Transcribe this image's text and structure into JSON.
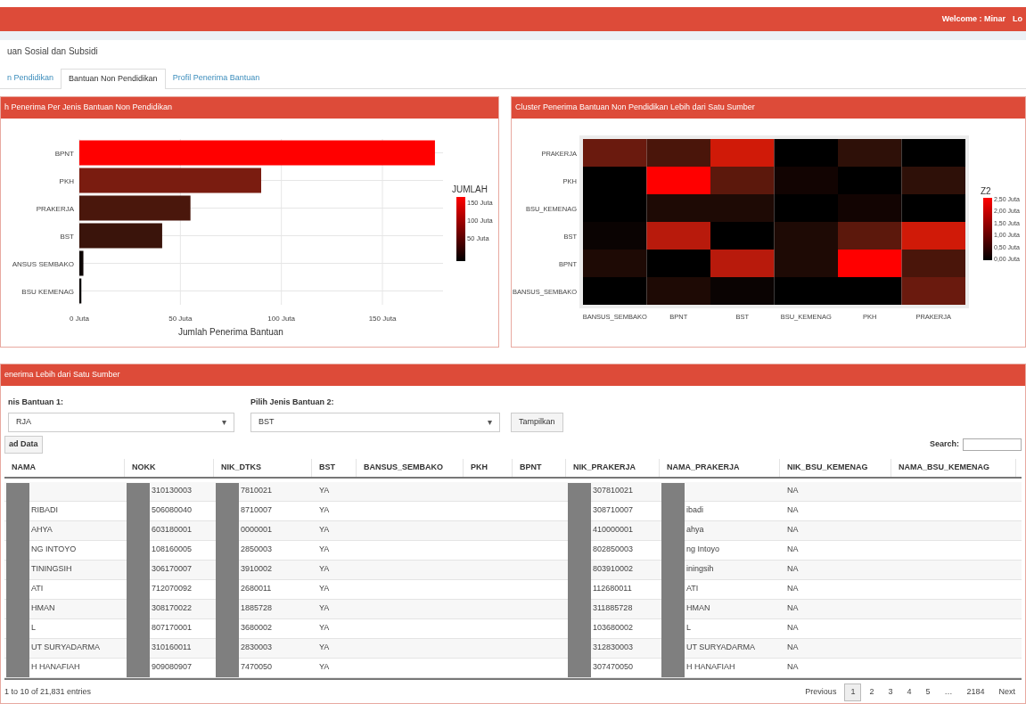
{
  "header": {
    "welcome": "Welcome : Minar",
    "logout": "Lo"
  },
  "page_title": "uan Sosial dan Subsidi",
  "tabs": [
    {
      "label": "n Pendidikan",
      "selected": false
    },
    {
      "label": "Bantuan Non Pendidikan",
      "selected": true
    },
    {
      "label": "Profil Penerima Bantuan",
      "selected": false
    }
  ],
  "bar_panel": {
    "title": "h Penerima Per Jenis Bantuan Non Pendidikan",
    "legend": {
      "title": "JUMLAH",
      "labels": [
        "150 Juta",
        "100 Juta",
        "50 Juta"
      ]
    },
    "chart_data": {
      "type": "bar",
      "orientation": "horizontal",
      "xlabel": "Jumlah Penerima Bantuan",
      "categories": [
        "BPNT",
        "PKH",
        "PRAKERJA",
        "BST",
        "ANSUS SEMBAKO",
        "BSU KEMENAG"
      ],
      "values": [
        176,
        90,
        55,
        41,
        2,
        1
      ],
      "colors": [
        "#ff0000",
        "#7a1c10",
        "#4a170c",
        "#3a140b",
        "#0d0504",
        "#080303"
      ],
      "grid": true,
      "xlim": [
        0,
        180
      ],
      "xticks": [
        {
          "value": 0,
          "label": "0 Juta"
        },
        {
          "value": 50,
          "label": "50 Juta"
        },
        {
          "value": 100,
          "label": "100 Juta"
        },
        {
          "value": 150,
          "label": "150 Juta"
        }
      ]
    }
  },
  "heatmap_panel": {
    "title": "Cluster Penerima Bantuan Non Pendidikan Lebih dari Satu Sumber",
    "columns": [
      "BANSUS_SEMBAKO",
      "BPNT",
      "BST",
      "BSU_KEMENAG",
      "PKH",
      "PRAKERJA"
    ],
    "rows": [
      {
        "label": "PRAKERJA",
        "cells": [
          {
            "color": "#6a1a0e"
          },
          {
            "color": "#4a150a"
          },
          {
            "color": "#d01a08"
          },
          {
            "color": "#000000"
          },
          {
            "color": "#2e1008"
          },
          {
            "color": "#000000"
          }
        ]
      },
      {
        "label": "PKH",
        "cells": [
          {
            "color": "#000000"
          },
          {
            "color": "#ff0000"
          },
          {
            "color": "#5c180c"
          },
          {
            "color": "#120402"
          },
          {
            "color": "#000000"
          },
          {
            "color": "#2e1008"
          }
        ]
      },
      {
        "label": "BSU_KEMENAG",
        "cells": [
          {
            "color": "#000000"
          },
          {
            "color": "#1e0a05"
          },
          {
            "color": "#1e0a05"
          },
          {
            "color": "#000000"
          },
          {
            "color": "#120402"
          },
          {
            "color": "#000000"
          }
        ]
      },
      {
        "label": "BST",
        "cells": [
          {
            "color": "#0a0302"
          },
          {
            "color": "#b81a0c"
          },
          {
            "color": "#000000"
          },
          {
            "color": "#1e0a05"
          },
          {
            "color": "#5c180c"
          },
          {
            "color": "#d01a08"
          }
        ]
      },
      {
        "label": "BPNT",
        "cells": [
          {
            "color": "#1e0a05"
          },
          {
            "color": "#000000"
          },
          {
            "color": "#b81a0c"
          },
          {
            "color": "#1e0a05"
          },
          {
            "color": "#ff0000"
          },
          {
            "color": "#4a150a"
          }
        ]
      },
      {
        "label": "BANSUS_SEMBAKO",
        "cells": [
          {
            "color": "#000000"
          },
          {
            "color": "#1e0a05"
          },
          {
            "color": "#0a0302"
          },
          {
            "color": "#000000"
          },
          {
            "color": "#000000"
          },
          {
            "color": "#6a1a0e"
          }
        ]
      }
    ],
    "legend": {
      "title": "Z2",
      "labels": [
        "2,50 Juta",
        "2,00 Juta",
        "1,50 Juta",
        "1,00 Juta",
        "0,50 Juta",
        "0,00 Juta"
      ]
    }
  },
  "table_panel": {
    "title": "enerima Lebih dari Satu Sumber",
    "select_1": {
      "label": "nis Bantuan 1:",
      "value": "RJA"
    },
    "select_2": {
      "label": "Pilih Jenis Bantuan 2:",
      "value": "BST"
    },
    "caret": "▾",
    "show_button": "Tampilkan",
    "download_button": "ad Data",
    "search_label": "Search:",
    "columns": [
      {
        "label": "NAMA",
        "redacted": true
      },
      {
        "label": "NOKK",
        "redacted": true
      },
      {
        "label": "NIK_DTKS",
        "redacted": true
      },
      {
        "label": "BST",
        "redacted": false
      },
      {
        "label": "BANSUS_SEMBAKO",
        "redacted": false
      },
      {
        "label": "PKH",
        "redacted": false
      },
      {
        "label": "BPNT",
        "redacted": false
      },
      {
        "label": "NIK_PRAKERJA",
        "redacted": true
      },
      {
        "label": "NAMA_PRAKERJA",
        "redacted": true
      },
      {
        "label": "NIK_BSU_KEMENAG",
        "redacted": false
      },
      {
        "label": "NAMA_BSU_KEMENAG",
        "redacted": false
      }
    ],
    "rows": [
      [
        null,
        "310130003",
        "7810021",
        "YA",
        null,
        null,
        null,
        "307810021",
        null,
        "NA",
        null
      ],
      [
        "RIBADI",
        "506080040",
        "8710007",
        "YA",
        null,
        null,
        null,
        "308710007",
        "ibadi",
        "NA",
        null
      ],
      [
        "AHYA",
        "603180001",
        "0000001",
        "YA",
        null,
        null,
        null,
        "410000001",
        "ahya",
        "NA",
        null
      ],
      [
        "NG INTOYO",
        "108160005",
        "2850003",
        "YA",
        null,
        null,
        null,
        "802850003",
        "ng Intoyo",
        "NA",
        null
      ],
      [
        "TININGSIH",
        "306170007",
        "3910002",
        "YA",
        null,
        null,
        null,
        "803910002",
        "iningsih",
        "NA",
        null
      ],
      [
        "ATI",
        "712070092",
        "2680011",
        "YA",
        null,
        null,
        null,
        "112680011",
        "ATI",
        "NA",
        null
      ],
      [
        "HMAN",
        "308170022",
        "1885728",
        "YA",
        null,
        null,
        null,
        "311885728",
        "HMAN",
        "NA",
        null
      ],
      [
        "L",
        "807170001",
        "3680002",
        "YA",
        null,
        null,
        null,
        "103680002",
        "L",
        "NA",
        null
      ],
      [
        "UT SURYADARMA",
        "310160011",
        "2830003",
        "YA",
        null,
        null,
        null,
        "312830003",
        "UT SURYADARMA",
        "NA",
        null
      ],
      [
        "H HANAFIAH",
        "909080907",
        "7470050",
        "YA",
        null,
        null,
        null,
        "307470050",
        "H HANAFIAH",
        "NA",
        null
      ]
    ],
    "info": "1 to 10 of 21,831 entries",
    "pagination": [
      {
        "label": "Previous",
        "selected": false
      },
      {
        "label": "1",
        "selected": true
      },
      {
        "label": "2",
        "selected": false
      },
      {
        "label": "3",
        "selected": false
      },
      {
        "label": "4",
        "selected": false
      },
      {
        "label": "5",
        "selected": false
      },
      {
        "label": "…",
        "selected": false
      },
      {
        "label": "2184",
        "selected": false
      },
      {
        "label": "Next",
        "selected": false
      }
    ]
  }
}
